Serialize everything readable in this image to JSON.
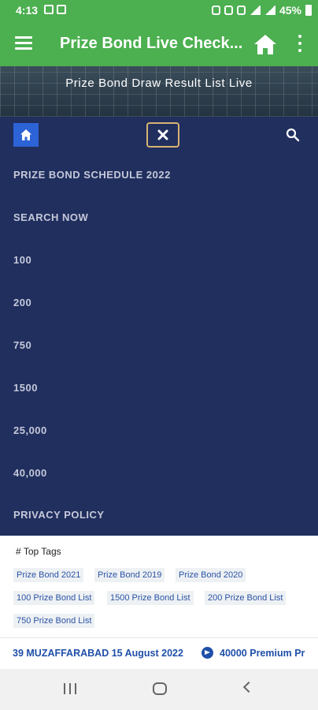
{
  "status_bar": {
    "time": "4:13",
    "battery": "45%"
  },
  "app_bar": {
    "title": "Prize Bond Live Check..."
  },
  "banner": {
    "title": "Prize Bond Draw Result List Live"
  },
  "nav_menu": {
    "items": [
      {
        "label": "PRIZE BOND SCHEDULE 2022"
      },
      {
        "label": "SEARCH NOW"
      },
      {
        "label": "100"
      },
      {
        "label": "200"
      },
      {
        "label": "750"
      },
      {
        "label": "1500"
      },
      {
        "label": "25,000"
      },
      {
        "label": "40,000"
      },
      {
        "label": "PRIVACY POLICY"
      }
    ]
  },
  "tags": {
    "heading_icon": "#",
    "heading": "Top Tags",
    "items": [
      {
        "label": "Prize Bond 2021"
      },
      {
        "label": "Prize Bond 2019"
      },
      {
        "label": "Prize Bond 2020"
      },
      {
        "label": "100 Prize Bond List"
      },
      {
        "label": "1500 Prize Bond List"
      },
      {
        "label": "200 Prize Bond List"
      },
      {
        "label": "750 Prize Bond List"
      }
    ]
  },
  "ticker": {
    "item1": "39 MUZAFFARABAD 15 August 2022",
    "item2": "40000 Premium Pr"
  },
  "colors": {
    "app_green": "#4caf50",
    "nav_panel": "#212f5f",
    "nav_home_btn": "#2c63d6",
    "close_border": "#d7b371",
    "tag_text": "#2a53a5"
  }
}
